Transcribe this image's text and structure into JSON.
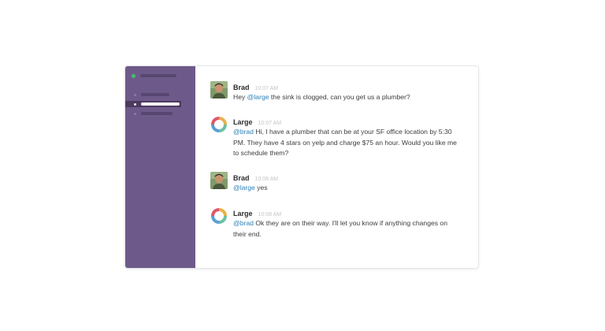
{
  "colors": {
    "sidebar_bg": "#6e5a8a",
    "sidebar_active": "#4c3a5f",
    "presence": "#3ec36a",
    "mention": "#2a80b9"
  },
  "messages": [
    {
      "author": "Brad",
      "time": "10:07 AM",
      "avatar": "brad-photo",
      "mention": "@large",
      "text": " the sink is clogged, can you get us a plumber?"
    },
    {
      "author": "Large",
      "time": "10:07 AM",
      "avatar": "large-logo",
      "mention": "@brad",
      "text": " Hi, I have a plumber that can be at your SF office location by 5:30 PM. They have 4 stars on yelp and charge $75 an hour. Would you like me to schedule them?"
    },
    {
      "author": "Brad",
      "time": "10:08 AM",
      "avatar": "brad-photo",
      "mention": "@large",
      "text": " yes"
    },
    {
      "author": "Large",
      "time": "10:08 AM",
      "avatar": "large-logo",
      "mention": "@brad",
      "text": " Ok they are on their way. I'll let you know if anything changes on their end."
    }
  ]
}
